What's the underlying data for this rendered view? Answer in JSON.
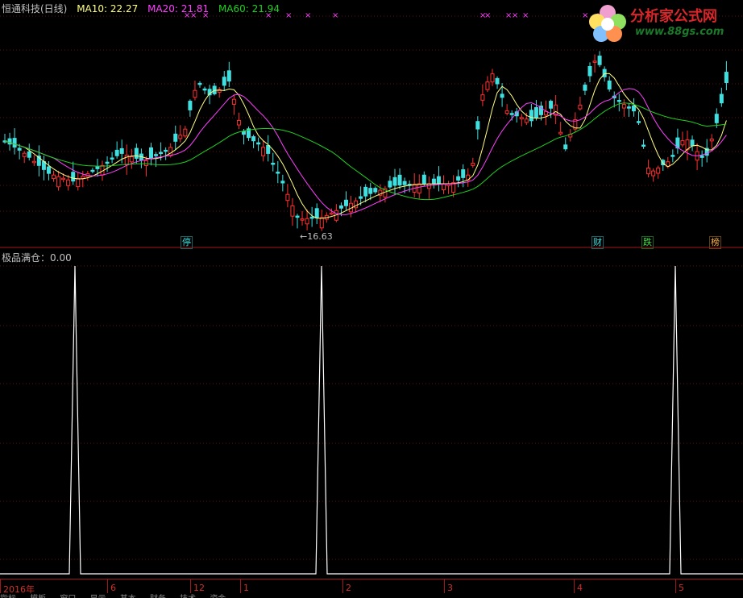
{
  "price_panel": {
    "title": "恒通科技(日线)",
    "ma10": "MA10: 22.27",
    "ma20": "MA20: 21.81",
    "ma60": "MA60: 21.94",
    "low_label": "←16.63",
    "tags": [
      "停",
      "财",
      "跌",
      "榜"
    ],
    "colors": {
      "ma10": "#ffff80",
      "ma20": "#ff40ff",
      "ma60": "#20d020",
      "up": "#ff3030",
      "down": "#40e0e0"
    }
  },
  "logo": {
    "title": "分析家公式网",
    "url": "www.88gs.com"
  },
  "indicator_panel": {
    "title": "极品满仓：0.00"
  },
  "time_axis": [
    "2016年",
    "6",
    "12",
    "1",
    "2",
    "3",
    "4",
    "5"
  ],
  "bottom_tabs": [
    "指标",
    "模板",
    "窗口",
    "显示",
    "基本",
    "财务",
    "技术",
    "资金"
  ]
}
